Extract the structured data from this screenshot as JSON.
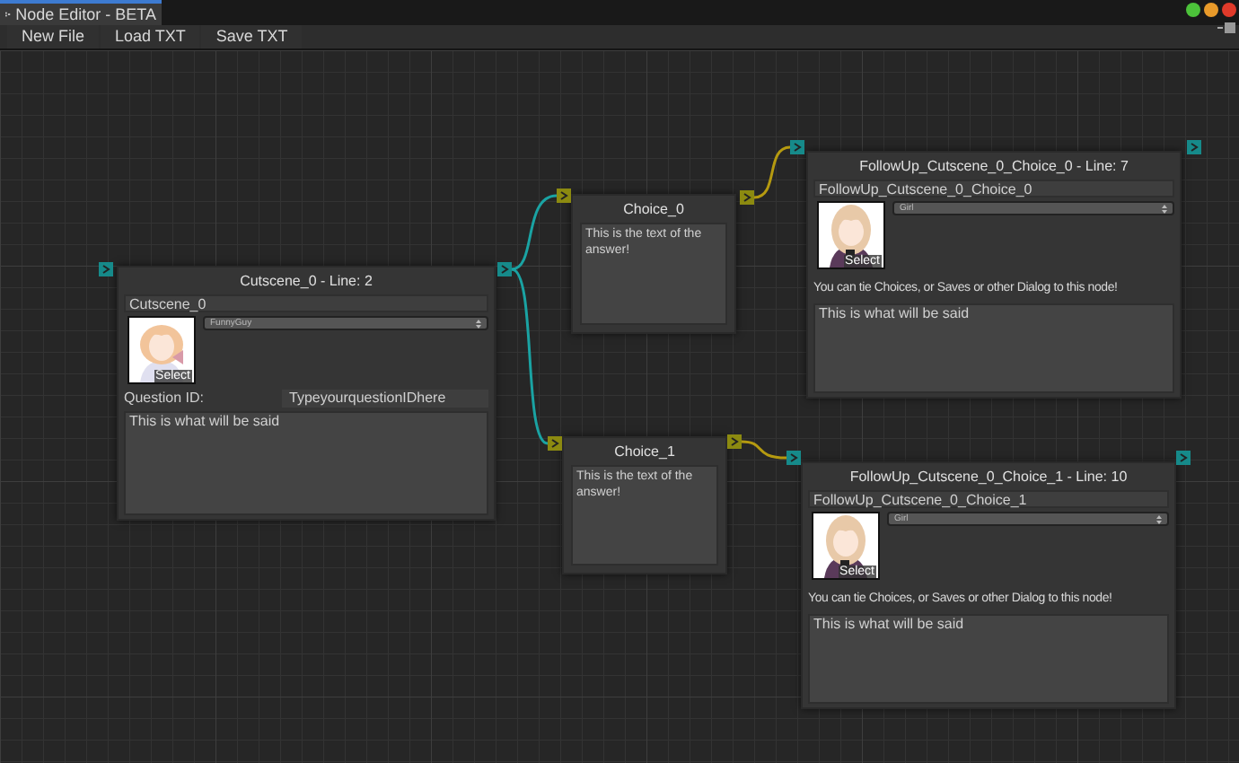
{
  "window": {
    "title": "Node Editor - BETA"
  },
  "toolbar": [
    "New File",
    "Load TXT",
    "Save TXT"
  ],
  "nodes": [
    {
      "kind": "cutscene",
      "title": "Cutscene_0 - Line: 2",
      "name": "Cutscene_0",
      "speaker": "FunnyGuy",
      "select_label": "Select",
      "question_label": "Question ID:",
      "question_value": "TypeyourquestionIDhere",
      "text": "This is what will be said"
    },
    {
      "kind": "choice",
      "title": "Choice_0",
      "text": "This is the text of the answer!"
    },
    {
      "kind": "choice",
      "title": "Choice_1",
      "text": "This is the text of the answer!"
    },
    {
      "kind": "followup",
      "title": "FollowUp_Cutscene_0_Choice_0 - Line: 7",
      "name": "FollowUp_Cutscene_0_Choice_0",
      "speaker": "Girl",
      "select_label": "Select",
      "note": "You can tie Choices, or Saves or other Dialog to this node!",
      "text": "This is what will be said"
    },
    {
      "kind": "followup",
      "title": "FollowUp_Cutscene_0_Choice_1 - Line: 10",
      "name": "FollowUp_Cutscene_0_Choice_1",
      "speaker": "Girl",
      "select_label": "Select",
      "note": "You can tie Choices, or Saves or other Dialog to this node!",
      "text": "This is what will be said"
    }
  ],
  "links": [
    {
      "color": "#1aa3a3"
    },
    {
      "color": "#1aa3a3"
    },
    {
      "color": "#b59a10"
    },
    {
      "color": "#b59a10"
    }
  ]
}
